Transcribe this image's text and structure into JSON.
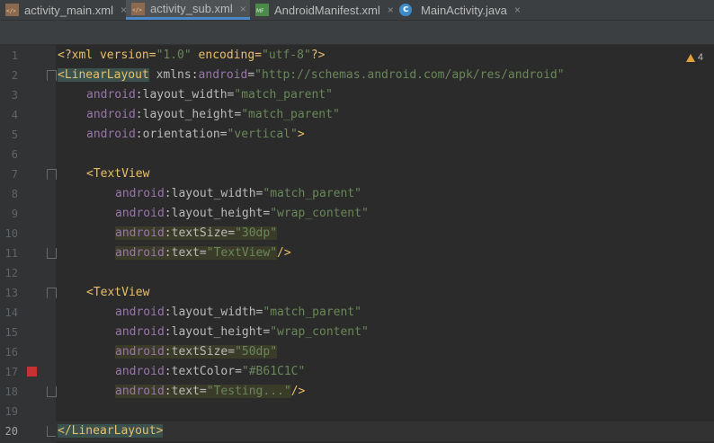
{
  "tabs": [
    {
      "label": "activity_main.xml",
      "icon": "xml-file-icon",
      "active": false
    },
    {
      "label": "activity_sub.xml",
      "icon": "xml-file-icon",
      "active": true
    },
    {
      "label": "AndroidManifest.xml",
      "icon": "manifest-file-icon",
      "active": false
    },
    {
      "label": "MainActivity.java",
      "icon": "java-class-icon",
      "active": false
    }
  ],
  "close_glyph": "×",
  "inspection": {
    "count": "4",
    "icon": "warning-icon"
  },
  "colors": {
    "tag": "#e8bf6a",
    "namespace": "#9876aa",
    "attribute": "#bababa",
    "value": "#6a8759",
    "breakpoint": "#c73131",
    "accent": "#4a88c7"
  },
  "lines": [
    {
      "n": "1",
      "parts": {
        "a": "<?xml version=",
        "b": "\"1.0\"",
        "c": " encoding=",
        "d": "\"utf-8\"",
        "e": "?>"
      }
    },
    {
      "n": "2",
      "parts": {
        "a": "<LinearLayout",
        "b": " xmlns:",
        "c": "android",
        "d": "=",
        "e": "\"http://schemas.android.com/apk/res/android\""
      }
    },
    {
      "n": "3",
      "parts": {
        "a": "android",
        "b": ":layout_width=",
        "c": "\"match_parent\""
      }
    },
    {
      "n": "4",
      "parts": {
        "a": "android",
        "b": ":layout_height=",
        "c": "\"match_parent\""
      }
    },
    {
      "n": "5",
      "parts": {
        "a": "android",
        "b": ":orientation=",
        "c": "\"vertical\"",
        "d": ">"
      }
    },
    {
      "n": "6"
    },
    {
      "n": "7",
      "parts": {
        "a": "<TextView"
      }
    },
    {
      "n": "8",
      "parts": {
        "a": "android",
        "b": ":layout_width=",
        "c": "\"match_parent\""
      }
    },
    {
      "n": "9",
      "parts": {
        "a": "android",
        "b": ":layout_height=",
        "c": "\"wrap_content\""
      }
    },
    {
      "n": "10",
      "parts": {
        "a": "android",
        "b": ":textSize=",
        "c": "\"30dp\""
      }
    },
    {
      "n": "11",
      "parts": {
        "a": "android",
        "b": ":text=",
        "c": "\"TextView\"",
        "d": "/>"
      }
    },
    {
      "n": "12"
    },
    {
      "n": "13",
      "parts": {
        "a": "<TextView"
      }
    },
    {
      "n": "14",
      "parts": {
        "a": "android",
        "b": ":layout_width=",
        "c": "\"match_parent\""
      }
    },
    {
      "n": "15",
      "parts": {
        "a": "android",
        "b": ":layout_height=",
        "c": "\"wrap_content\""
      }
    },
    {
      "n": "16",
      "parts": {
        "a": "android",
        "b": ":textSize=",
        "c": "\"50dp\""
      }
    },
    {
      "n": "17",
      "parts": {
        "a": "android",
        "b": ":textColor=",
        "c": "\"#B61C1C\""
      }
    },
    {
      "n": "18",
      "parts": {
        "a": "android",
        "b": ":text=",
        "c": "\"Testing...\"",
        "d": "/>"
      }
    },
    {
      "n": "19"
    },
    {
      "n": "20",
      "parts": {
        "a": "</LinearLayout>"
      }
    }
  ]
}
